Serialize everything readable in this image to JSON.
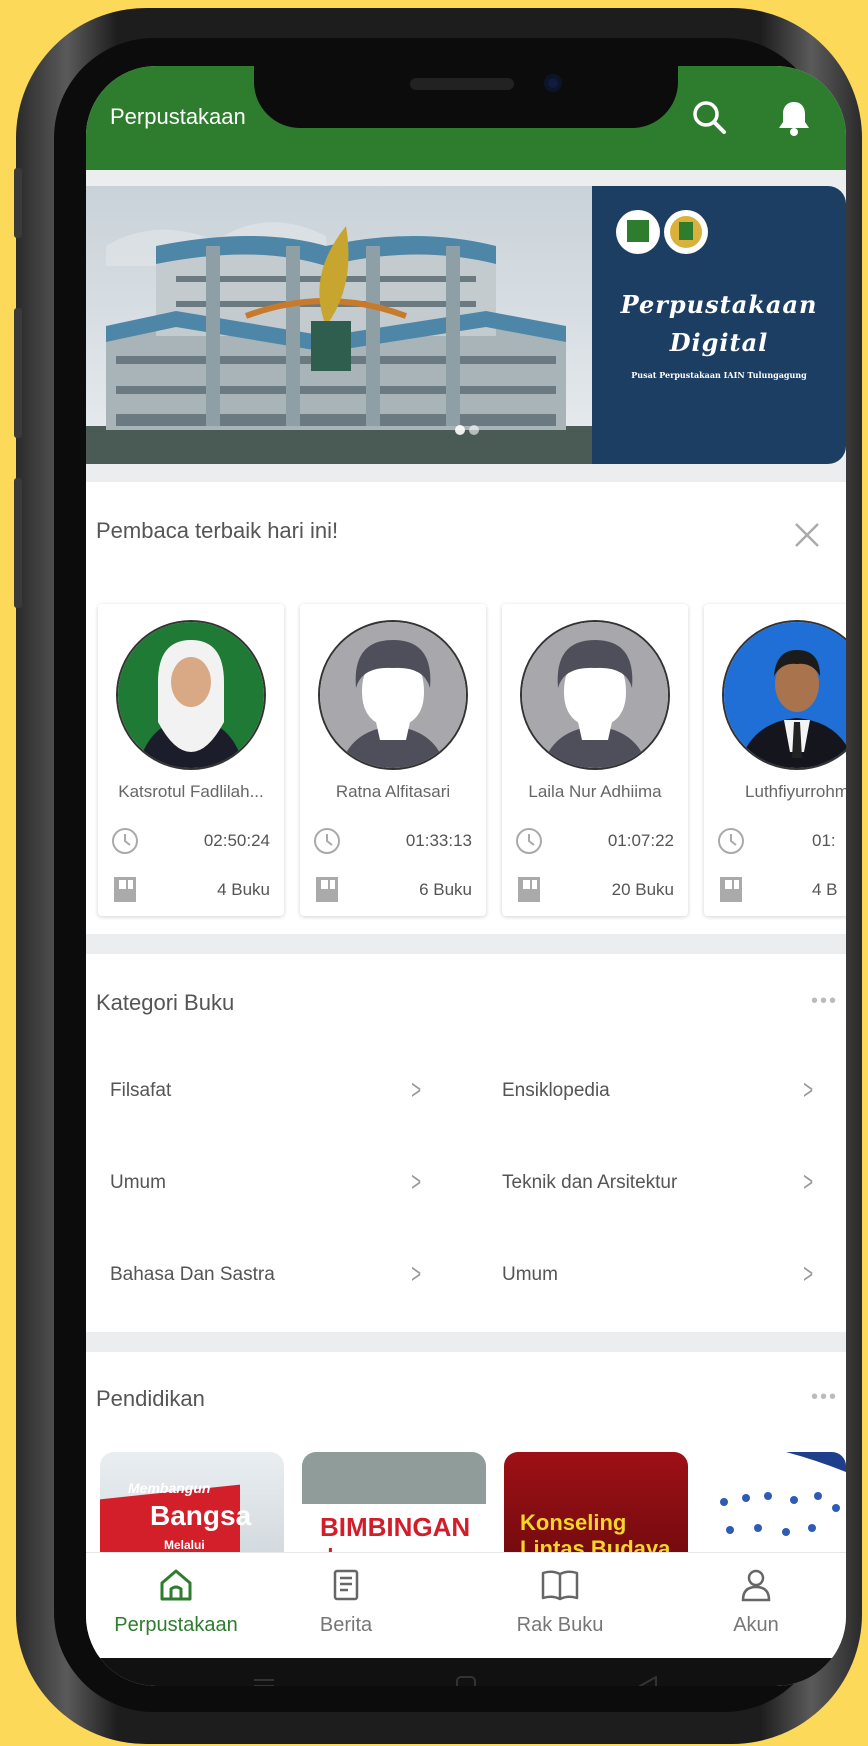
{
  "app": {
    "title": "Perpustakaan"
  },
  "banner": {
    "title_line1": "Perpustakaan",
    "title_line2": "Digital",
    "subtitle": "Pusat Perpustakaan IAIN Tulungagung"
  },
  "best_readers": {
    "title": "Pembaca terbaik hari ini!",
    "readers": [
      {
        "name": "Katsrotul Fadlilah...",
        "time": "02:50:24",
        "books": "4 Buku"
      },
      {
        "name": "Ratna Alfitasari",
        "time": "01:33:13",
        "books": "6 Buku"
      },
      {
        "name": "Laila Nur Adhiima",
        "time": "01:07:22",
        "books": "20 Buku"
      },
      {
        "name": "Luthfiyurrohm",
        "time": "01:",
        "books": "4 B"
      }
    ]
  },
  "categories": {
    "title": "Kategori Buku",
    "items": [
      "Filsafat",
      "Ensiklopedia",
      "Umum",
      "Teknik dan Arsitektur",
      "Bahasa Dan Sastra",
      "Umum"
    ]
  },
  "pendidikan": {
    "title": "Pendidikan",
    "books": [
      {
        "line1": "Membangun",
        "line2": "Bangsa",
        "line3": "Melalui"
      },
      {
        "line1": "BIMBINGAN",
        "line2": "dan KONSELING"
      },
      {
        "line1": "Konseling",
        "line2": "Lintas Budaya"
      },
      {
        "line1": ""
      }
    ]
  },
  "nav": {
    "items": [
      {
        "label": "Perpustakaan"
      },
      {
        "label": "Berita"
      },
      {
        "label": "Rak Buku"
      },
      {
        "label": "Akun"
      }
    ]
  },
  "colors": {
    "primary": "#2e7d2e",
    "background": "#fdd95a",
    "banner_blue": "#1d3e63"
  }
}
